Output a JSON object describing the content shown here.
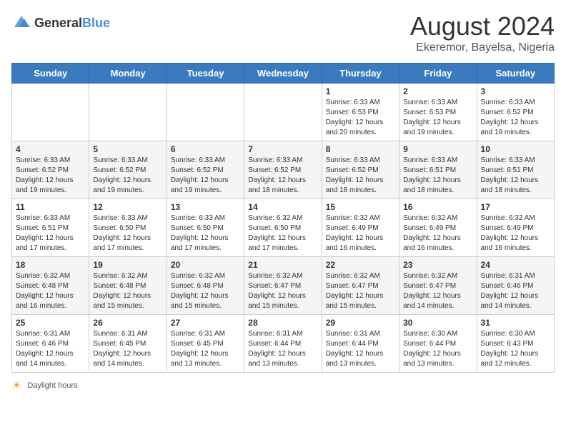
{
  "header": {
    "logo_general": "General",
    "logo_blue": "Blue",
    "month_year": "August 2024",
    "location": "Ekeremor, Bayelsa, Nigeria"
  },
  "calendar": {
    "days_of_week": [
      "Sunday",
      "Monday",
      "Tuesday",
      "Wednesday",
      "Thursday",
      "Friday",
      "Saturday"
    ],
    "weeks": [
      [
        {
          "day": "",
          "info": ""
        },
        {
          "day": "",
          "info": ""
        },
        {
          "day": "",
          "info": ""
        },
        {
          "day": "",
          "info": ""
        },
        {
          "day": "1",
          "info": "Sunrise: 6:33 AM\nSunset: 6:53 PM\nDaylight: 12 hours and 20 minutes."
        },
        {
          "day": "2",
          "info": "Sunrise: 6:33 AM\nSunset: 6:53 PM\nDaylight: 12 hours and 19 minutes."
        },
        {
          "day": "3",
          "info": "Sunrise: 6:33 AM\nSunset: 6:52 PM\nDaylight: 12 hours and 19 minutes."
        }
      ],
      [
        {
          "day": "4",
          "info": "Sunrise: 6:33 AM\nSunset: 6:52 PM\nDaylight: 12 hours and 19 minutes."
        },
        {
          "day": "5",
          "info": "Sunrise: 6:33 AM\nSunset: 6:52 PM\nDaylight: 12 hours and 19 minutes."
        },
        {
          "day": "6",
          "info": "Sunrise: 6:33 AM\nSunset: 6:52 PM\nDaylight: 12 hours and 19 minutes."
        },
        {
          "day": "7",
          "info": "Sunrise: 6:33 AM\nSunset: 6:52 PM\nDaylight: 12 hours and 18 minutes."
        },
        {
          "day": "8",
          "info": "Sunrise: 6:33 AM\nSunset: 6:52 PM\nDaylight: 12 hours and 18 minutes."
        },
        {
          "day": "9",
          "info": "Sunrise: 6:33 AM\nSunset: 6:51 PM\nDaylight: 12 hours and 18 minutes."
        },
        {
          "day": "10",
          "info": "Sunrise: 6:33 AM\nSunset: 6:51 PM\nDaylight: 12 hours and 18 minutes."
        }
      ],
      [
        {
          "day": "11",
          "info": "Sunrise: 6:33 AM\nSunset: 6:51 PM\nDaylight: 12 hours and 17 minutes."
        },
        {
          "day": "12",
          "info": "Sunrise: 6:33 AM\nSunset: 6:50 PM\nDaylight: 12 hours and 17 minutes."
        },
        {
          "day": "13",
          "info": "Sunrise: 6:33 AM\nSunset: 6:50 PM\nDaylight: 12 hours and 17 minutes."
        },
        {
          "day": "14",
          "info": "Sunrise: 6:32 AM\nSunset: 6:50 PM\nDaylight: 12 hours and 17 minutes."
        },
        {
          "day": "15",
          "info": "Sunrise: 6:32 AM\nSunset: 6:49 PM\nDaylight: 12 hours and 16 minutes."
        },
        {
          "day": "16",
          "info": "Sunrise: 6:32 AM\nSunset: 6:49 PM\nDaylight: 12 hours and 16 minutes."
        },
        {
          "day": "17",
          "info": "Sunrise: 6:32 AM\nSunset: 6:49 PM\nDaylight: 12 hours and 16 minutes."
        }
      ],
      [
        {
          "day": "18",
          "info": "Sunrise: 6:32 AM\nSunset: 6:48 PM\nDaylight: 12 hours and 16 minutes."
        },
        {
          "day": "19",
          "info": "Sunrise: 6:32 AM\nSunset: 6:48 PM\nDaylight: 12 hours and 15 minutes."
        },
        {
          "day": "20",
          "info": "Sunrise: 6:32 AM\nSunset: 6:48 PM\nDaylight: 12 hours and 15 minutes."
        },
        {
          "day": "21",
          "info": "Sunrise: 6:32 AM\nSunset: 6:47 PM\nDaylight: 12 hours and 15 minutes."
        },
        {
          "day": "22",
          "info": "Sunrise: 6:32 AM\nSunset: 6:47 PM\nDaylight: 12 hours and 15 minutes."
        },
        {
          "day": "23",
          "info": "Sunrise: 6:32 AM\nSunset: 6:47 PM\nDaylight: 12 hours and 14 minutes."
        },
        {
          "day": "24",
          "info": "Sunrise: 6:31 AM\nSunset: 6:46 PM\nDaylight: 12 hours and 14 minutes."
        }
      ],
      [
        {
          "day": "25",
          "info": "Sunrise: 6:31 AM\nSunset: 6:46 PM\nDaylight: 12 hours and 14 minutes."
        },
        {
          "day": "26",
          "info": "Sunrise: 6:31 AM\nSunset: 6:45 PM\nDaylight: 12 hours and 14 minutes."
        },
        {
          "day": "27",
          "info": "Sunrise: 6:31 AM\nSunset: 6:45 PM\nDaylight: 12 hours and 13 minutes."
        },
        {
          "day": "28",
          "info": "Sunrise: 6:31 AM\nSunset: 6:44 PM\nDaylight: 12 hours and 13 minutes."
        },
        {
          "day": "29",
          "info": "Sunrise: 6:31 AM\nSunset: 6:44 PM\nDaylight: 12 hours and 13 minutes."
        },
        {
          "day": "30",
          "info": "Sunrise: 6:30 AM\nSunset: 6:44 PM\nDaylight: 12 hours and 13 minutes."
        },
        {
          "day": "31",
          "info": "Sunrise: 6:30 AM\nSunset: 6:43 PM\nDaylight: 12 hours and 12 minutes."
        }
      ]
    ]
  },
  "footer": {
    "daylight_label": "Daylight hours"
  }
}
